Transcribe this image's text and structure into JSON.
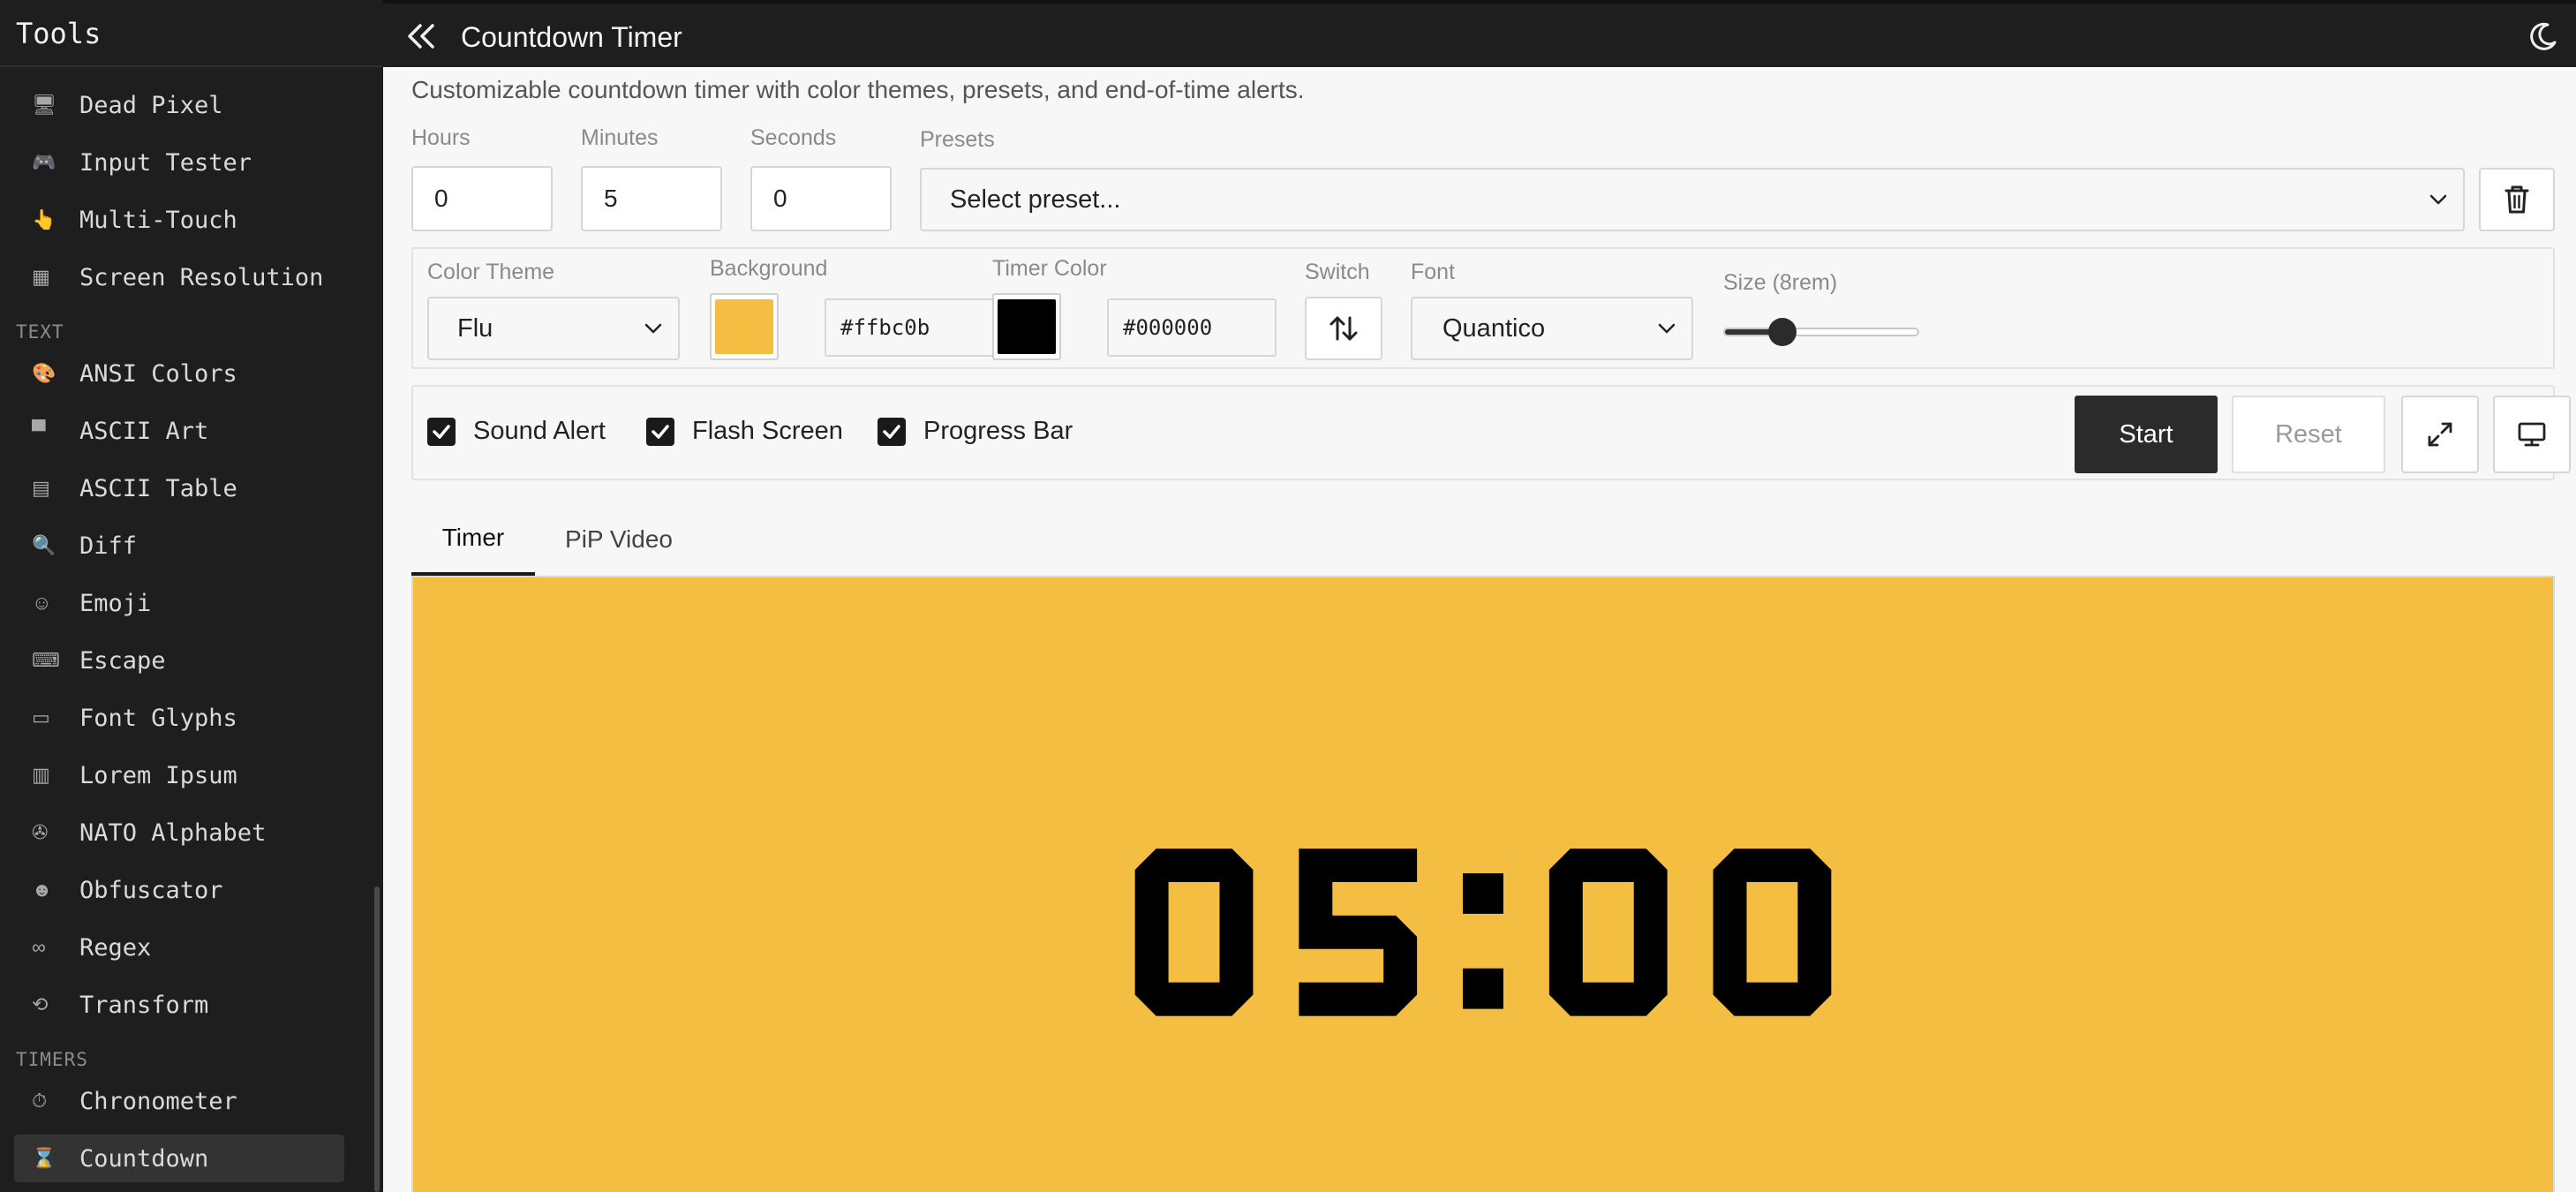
{
  "sidebar": {
    "title": "Tools",
    "items": [
      {
        "label": "Dead Pixel",
        "icon": "monitor-icon"
      },
      {
        "label": "Input Tester",
        "icon": "gamepad-icon"
      },
      {
        "label": "Multi-Touch",
        "icon": "pointing-hand-icon"
      },
      {
        "label": "Screen Resolution",
        "icon": "screen-icon"
      },
      {
        "label": "ANSI Colors",
        "icon": "palette-icon"
      },
      {
        "label": "ASCII Art",
        "icon": "easel-icon"
      },
      {
        "label": "ASCII Table",
        "icon": "clipboard-icon"
      },
      {
        "label": "Diff",
        "icon": "magnifier-icon"
      },
      {
        "label": "Emoji",
        "icon": "smiley-icon"
      },
      {
        "label": "Escape",
        "icon": "keyboard-icon"
      },
      {
        "label": "Font Glyphs",
        "icon": "abcd-icon"
      },
      {
        "label": "Lorem Ipsum",
        "icon": "scroll-icon"
      },
      {
        "label": "NATO Alphabet",
        "icon": "radio-icon"
      },
      {
        "label": "Obfuscator",
        "icon": "disguise-icon"
      },
      {
        "label": "Regex",
        "icon": "pretzel-icon"
      },
      {
        "label": "Transform",
        "icon": "cycle-icon"
      },
      {
        "label": "Chronometer",
        "icon": "stopwatch-icon"
      },
      {
        "label": "Countdown",
        "icon": "hourglass-icon"
      }
    ],
    "sections": {
      "text": "TEXT",
      "timers": "TIMERS"
    },
    "active": "Countdown"
  },
  "header": {
    "title": "Countdown Timer"
  },
  "main": {
    "description": "Customizable countdown timer with color themes, presets, and end-of-time alerts.",
    "hours": {
      "label": "Hours",
      "value": "0"
    },
    "minutes": {
      "label": "Minutes",
      "value": "5"
    },
    "seconds": {
      "label": "Seconds",
      "value": "0"
    },
    "presets": {
      "label": "Presets",
      "placeholder": "Select preset..."
    },
    "color_theme": {
      "label": "Color Theme",
      "value": "Flu"
    },
    "background": {
      "label": "Background",
      "value": "#ffbc0b",
      "swatch": "#f4be42"
    },
    "timer_color": {
      "label": "Timer Color",
      "value": "#000000",
      "swatch": "#000000"
    },
    "switch_label": "Switch",
    "font": {
      "label": "Font",
      "value": "Quantico"
    },
    "size": {
      "label": "Size (8rem)",
      "fraction": 0.3
    },
    "options": {
      "sound_alert": {
        "label": "Sound Alert",
        "checked": true
      },
      "flash_screen": {
        "label": "Flash Screen",
        "checked": true
      },
      "progress_bar": {
        "label": "Progress Bar",
        "checked": true
      }
    },
    "start_label": "Start",
    "reset_label": "Reset",
    "tabs": [
      {
        "label": "Timer",
        "active": true
      },
      {
        "label": "PiP Video",
        "active": false
      }
    ],
    "timer_display": "05:00",
    "colors": {
      "panel_bg": "#f4be42",
      "digits": "#000000"
    }
  }
}
